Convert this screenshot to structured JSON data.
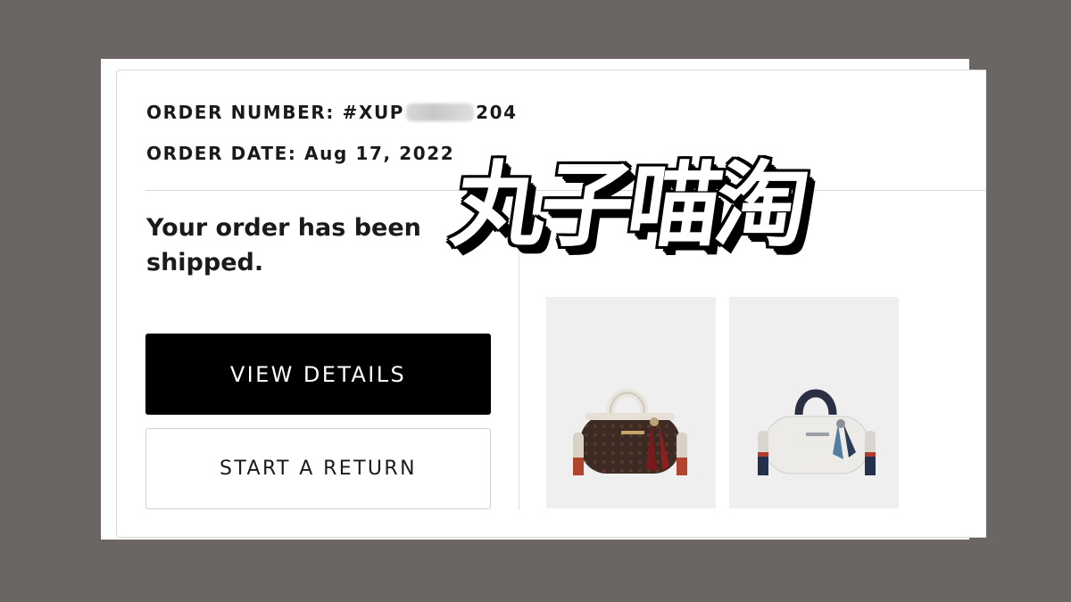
{
  "order": {
    "number_label": "ORDER NUMBER:",
    "number_prefix": "#XUP",
    "number_suffix": "204",
    "date_label": "ORDER DATE:",
    "date_value": "Aug 17, 2022"
  },
  "status": {
    "message": "Your order has been shipped."
  },
  "actions": {
    "view_details_label": "VIEW DETAILS",
    "start_return_label": "START A RETURN"
  },
  "products": [
    {
      "icon": "brown-signature-barrel-bag"
    },
    {
      "icon": "white-leather-barrel-bag"
    }
  ],
  "watermark": {
    "text": "丸子喵淘"
  },
  "colors": {
    "backdrop": "#6b6663",
    "primary_button": "#000000",
    "border": "#d9d9d9"
  }
}
